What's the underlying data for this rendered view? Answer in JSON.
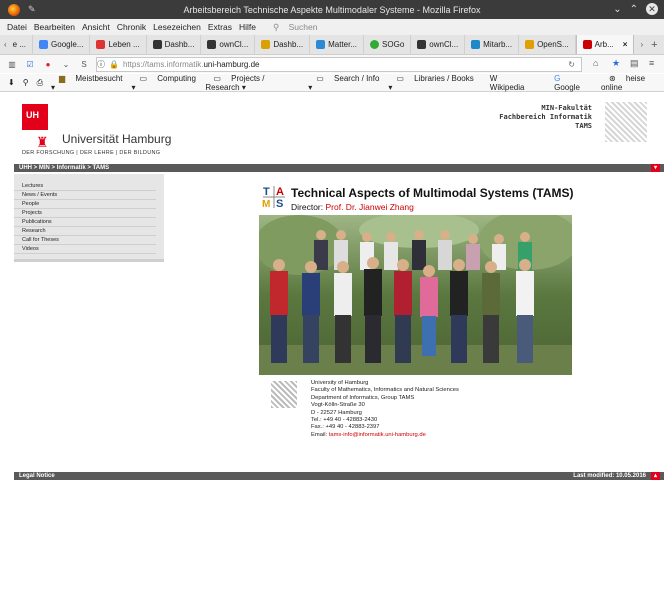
{
  "window": {
    "title": "Arbeitsbereich Technische Aspekte Multimodaler Systeme - Mozilla Firefox"
  },
  "menu": [
    "Datei",
    "Bearbeiten",
    "Ansicht",
    "Chronik",
    "Lesezeichen",
    "Extras",
    "Hilfe"
  ],
  "search_placeholder": "Suchen",
  "tabs": [
    {
      "label": "e ...",
      "color": "#777"
    },
    {
      "label": "Google...",
      "color": "#4285f4"
    },
    {
      "label": "Leben ...",
      "color": "#d33"
    },
    {
      "label": "Dashb...",
      "color": "#333"
    },
    {
      "label": "ownCl...",
      "color": "#333"
    },
    {
      "label": "Dashb...",
      "color": "#d9a000"
    },
    {
      "label": "Matter...",
      "color": "#2b8ad8"
    },
    {
      "label": "SOGo",
      "color": "#3a3"
    },
    {
      "label": "ownCl...",
      "color": "#333"
    },
    {
      "label": "Mitarb...",
      "color": "#1e88c9"
    },
    {
      "label": "OpenS...",
      "color": "#e0a000"
    },
    {
      "label": "Arb...",
      "color": "#c00"
    }
  ],
  "url": {
    "prefix": "https://tams.informatik.",
    "domain": "uni-hamburg.de"
  },
  "bookmarks": [
    "Meistbesucht",
    "Computing",
    "Projects / Research",
    "Search / Info",
    "Libraries / Books",
    "Wikipedia",
    "Google",
    "heise online"
  ],
  "uhh": {
    "logo_text": "UH",
    "name": "Universität Hamburg",
    "slogan": "DER FORSCHUNG | DER LEHRE | DER BILDUNG"
  },
  "faculty": [
    "MIN-Fakultät",
    "Fachbereich Informatik",
    "TAMS"
  ],
  "breadcrumb": "UHH > MIN > Informatik > TAMS",
  "sidebar": [
    "Lectures",
    "News / Events",
    "People",
    "Projects",
    "Publications",
    "Research",
    "Call for Theses",
    "Videos"
  ],
  "heading": "Technical Aspects of Multimodal Systems (TAMS)",
  "director": {
    "label": "Director:",
    "name": "Prof. Dr. Jianwei Zhang"
  },
  "address": {
    "lines": [
      "University of Hamburg",
      "Faculty of Mathematics, Informatics and Natural Sciences",
      "Department of Informatics, Group TAMS",
      "Vogt-Kölln-Straße 30",
      "D - 22527 Hamburg",
      "Tel.: +49 40 - 42883-2430",
      "Fax.: +49 40 - 42883-2397"
    ],
    "email_label": "Email:",
    "email": "tams-info@informatik.uni-hamburg.de"
  },
  "footer": {
    "left": "Legal Notice",
    "right": "Last modified: 10.05.2016"
  }
}
